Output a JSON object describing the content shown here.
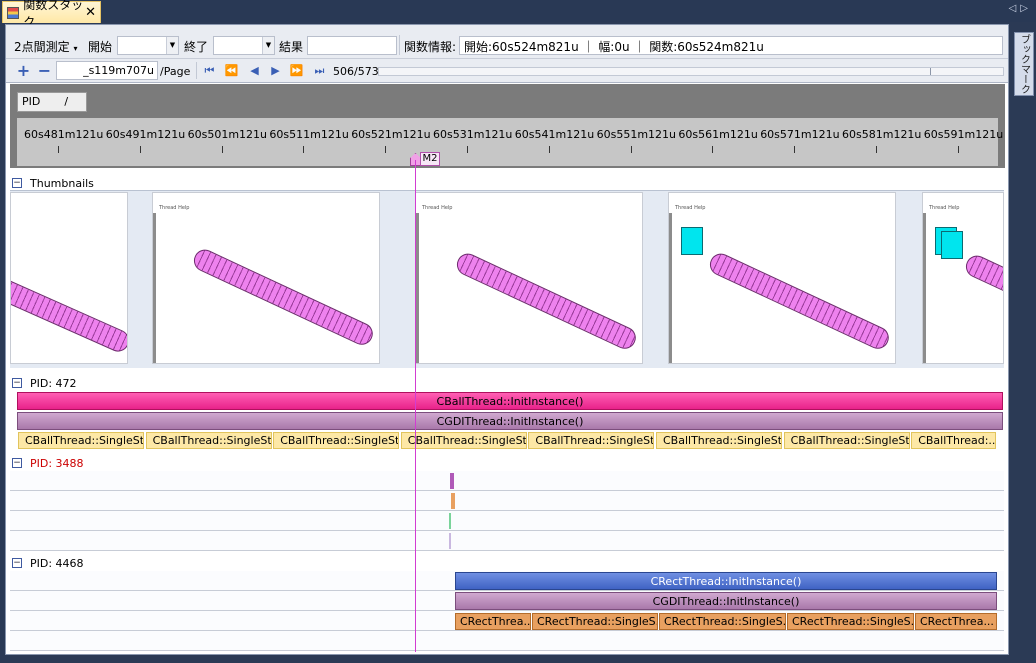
{
  "tab": {
    "title": "関数スタック",
    "close": "✕"
  },
  "nav_arrows": "◁▷",
  "sidebar_label": "ブックマーク",
  "toolbar": {
    "measure_label": "2点間測定",
    "start_label": "開始",
    "end_label": "終了",
    "result_label": "結果",
    "info_label": "関数情報:",
    "info_value": "開始:60s524m821u ｜ 幅:0u ｜ 関数:60s524m821u",
    "page_value": "_s119m707u",
    "page_unit": "/Page",
    "counter": "506/573"
  },
  "pid_header": {
    "label": "PID",
    "sort": "/"
  },
  "ruler": {
    "labels": [
      "60s481m121u",
      "60s491m121u",
      "60s501m121u",
      "60s511m121u",
      "60s521m121u",
      "60s531m121u",
      "60s541m121u",
      "60s551m121u",
      "60s561m121u",
      "60s571m121u",
      "60s581m121u",
      "60s591m121u"
    ],
    "marker": "M2"
  },
  "sections": {
    "thumbnails": "Thumbnails",
    "pid1": "PID: 472",
    "pid2": "PID: 3488",
    "pid3": "PID: 4468"
  },
  "thumb_menu": "Thread   Help",
  "pid472": {
    "init": "CBallThread::InitInstance()",
    "gdi": "CGDIThread::InitInstance()",
    "segments": [
      "CBallThread::SingleSt...",
      "CBallThread::SingleSt...",
      "CBallThread::SingleSt...",
      "CBallThread::SingleSt...",
      "CBallThread::SingleSt...",
      "CBallThread::SingleSt...",
      "CBallThread::SingleSt...",
      "CBallThread:..."
    ]
  },
  "pid4468": {
    "init": "CRectThread::InitInstance()",
    "gdi": "CGDIThread::InitInstance()",
    "segments": [
      "CRectThrea...",
      "CRectThread::SingleS...",
      "CRectThread::SingleS...",
      "CRectThread::SingleS...",
      "CRectThrea..."
    ]
  },
  "colors": {
    "pink": "#e8228a",
    "mauve": "#b78cb8",
    "blue": "#3f63c4",
    "orange": "#e8a060",
    "red_pid": "#cc0000"
  }
}
